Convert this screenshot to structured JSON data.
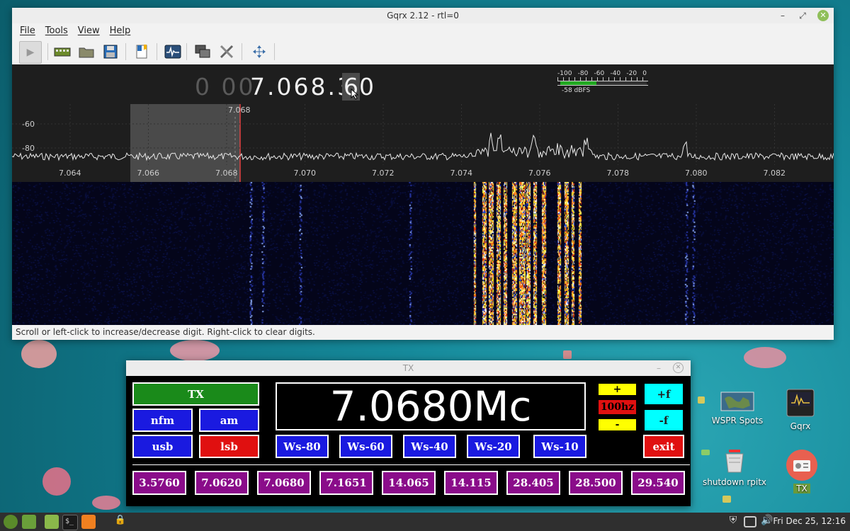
{
  "gqrx": {
    "title": "Gqrx 2.12 - rtl=0",
    "menu": [
      "File",
      "Tools",
      "View",
      "Help"
    ],
    "toolbar_icons": [
      "play-icon",
      "hardware-icon",
      "open-folder-icon",
      "save-icon",
      "bookmark-icon",
      "spectrum-icon",
      "network-icon",
      "tools-icon",
      "fullscreen-icon"
    ],
    "frequency_dim": "0 00",
    "frequency_main": "7.068.3",
    "frequency_hl": "6",
    "frequency_tail": "0",
    "smeter": {
      "scale": [
        "-100",
        "-80",
        "-60",
        "-40",
        "-20",
        "0"
      ],
      "reading": "-58 dBFS",
      "level_fraction": 0.42
    },
    "spectrum": {
      "y_labels": [
        "-60",
        "-80"
      ],
      "x_labels": [
        "7.064",
        "7.066",
        "7.068",
        "7.070",
        "7.072",
        "7.074",
        "7.076",
        "7.078",
        "7.080",
        "7.082"
      ],
      "marker_label": "7.068"
    },
    "status": "Scroll or left-click to increase/decrease digit. Right-click to clear digits."
  },
  "tx": {
    "title": "TX",
    "tx_button": "TX",
    "frequency": "7.0680Mc",
    "modes": [
      "nfm",
      "am",
      "usb",
      "lsb"
    ],
    "step_plus": "+",
    "step_value": "100hz",
    "step_minus": "-",
    "plus_f": "+f",
    "minus_f": "-f",
    "ws_buttons": [
      "Ws-80",
      "Ws-60",
      "Ws-40",
      "Ws-20",
      "Ws-10"
    ],
    "exit": "exit",
    "presets": [
      "3.5760",
      "7.0620",
      "7.0680",
      "7.1651",
      "14.065",
      "14.115",
      "28.405",
      "28.500",
      "29.540"
    ]
  },
  "desktop": {
    "icons": [
      {
        "label": "WSPR Spots",
        "icon": "map-icon"
      },
      {
        "label": "Gqrx",
        "icon": "gqrx-icon"
      },
      {
        "label": "shutdown rpitx",
        "icon": "shutdown-icon"
      },
      {
        "label": "TX",
        "icon": "radio-icon"
      }
    ]
  },
  "taskbar": {
    "clock": "Fri Dec 25, 12:16"
  },
  "colors": {
    "tx_green": "#1a8a1a",
    "blue": "#1a1ae0",
    "red": "#e01010",
    "purple": "#8a0c8a",
    "cyan": "#00ffff",
    "yellow": "#ffff00"
  }
}
